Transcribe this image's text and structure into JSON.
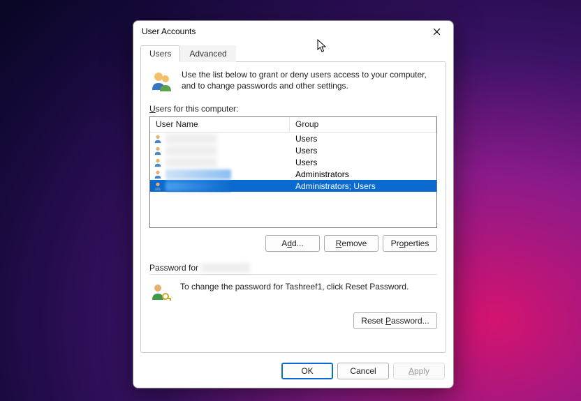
{
  "window": {
    "title": "User Accounts"
  },
  "tabs": {
    "users": "Users",
    "advanced": "Advanced"
  },
  "intro": "Use the list below to grant or deny users access to your computer, and to change passwords and other settings.",
  "list_label_prefix": "U",
  "list_label_rest": "sers for this computer:",
  "columns": {
    "user": "User Name",
    "group": "Group"
  },
  "rows": [
    {
      "name": "████",
      "group": "Users",
      "selected": false
    },
    {
      "name": "████",
      "group": "Users",
      "selected": false
    },
    {
      "name": "████",
      "group": "Users",
      "selected": false
    },
    {
      "name": "████",
      "group": "Administrators",
      "selected": false
    },
    {
      "name": "████",
      "group": "Administrators; Users",
      "selected": true
    }
  ],
  "buttons": {
    "add": "Add...",
    "remove": "Remove",
    "properties": "Properties",
    "reset_password": "Reset Password...",
    "ok": "OK",
    "cancel": "Cancel",
    "apply": "Apply"
  },
  "password_section": {
    "label_prefix": "Password for",
    "label_user": "████",
    "text": "To change the password for Tashreef1, click Reset Password."
  }
}
